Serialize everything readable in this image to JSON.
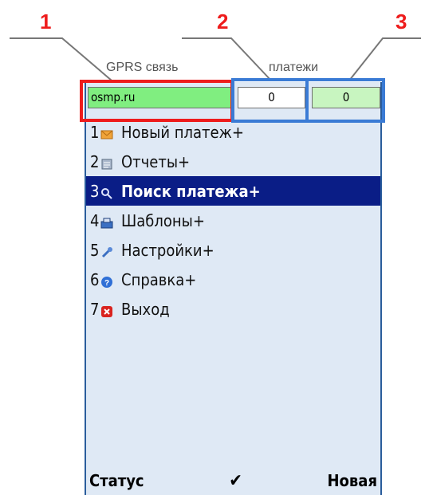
{
  "callouts": [
    "1",
    "2",
    "3"
  ],
  "captions": {
    "connection": "GPRS связь",
    "payments": "платежи"
  },
  "status": {
    "server": "osmp.ru",
    "counter_a": "0",
    "counter_b": "0"
  },
  "menu": {
    "items": [
      {
        "number": "1",
        "label": "Новый платеж+",
        "icon": "envelope-icon",
        "selected": false
      },
      {
        "number": "2",
        "label": "Отчеты+",
        "icon": "report-icon",
        "selected": false
      },
      {
        "number": "3",
        "label": "Поиск платежа+",
        "icon": "search-icon",
        "selected": true
      },
      {
        "number": "4",
        "label": "Шаблоны+",
        "icon": "templates-icon",
        "selected": false
      },
      {
        "number": "5",
        "label": "Настройки+",
        "icon": "settings-icon",
        "selected": false
      },
      {
        "number": "6",
        "label": "Справка+",
        "icon": "help-icon",
        "selected": false
      },
      {
        "number": "7",
        "label": "Выход",
        "icon": "exit-icon",
        "selected": false
      }
    ]
  },
  "softkeys": {
    "left": "Статус",
    "middle": "✔",
    "right": "Новая"
  },
  "colors": {
    "callout_1": "#ee1c1c",
    "callout_2_3": "#3a7bd5",
    "selection": "#0a1d86",
    "screen_bg": "#dfe9f5",
    "server_field": "#80ee80",
    "counter_b_field": "#c8f5c0"
  }
}
